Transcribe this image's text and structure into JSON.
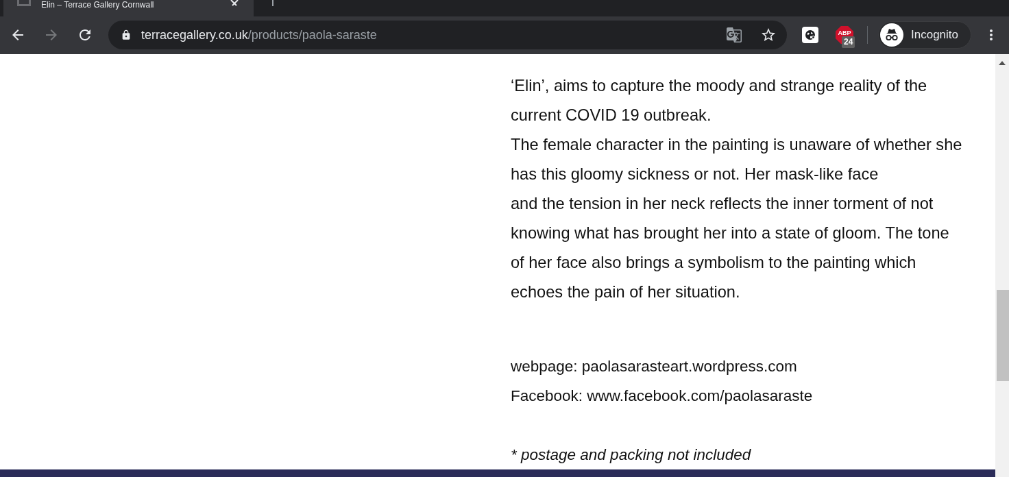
{
  "tab": {
    "title": "Elin – Terrace Gallery Cornwall"
  },
  "toolbar": {
    "navigation": [
      {
        "kind": "back",
        "disabled": false
      },
      {
        "kind": "forward",
        "disabled": true
      },
      {
        "kind": "reload",
        "disabled": false
      }
    ],
    "address_bar": {
      "domain": "terracegallery.co.uk",
      "path": "/products/paola-saraste"
    },
    "bookmarked": false,
    "extensions": [
      {
        "kind": "globe"
      },
      {
        "kind": "adblock",
        "label": "ABP",
        "badge": "24"
      }
    ],
    "profile": {
      "label": "Incognito"
    }
  },
  "page": {
    "paragraphs": [
      "‘Elin’, aims to capture the moody and strange reality of the current COVID 19 outbreak.",
      "The female character in the painting is unaware of whether she has this gloomy sickness or not. Her mask-like face",
      "and the tension in her neck reflects the inner torment of not knowing what has brought her into a state of gloom. The tone of her face also brings a symbolism to the painting which echoes the pain of her situation."
    ],
    "contacts": [
      "webpage: paolasarasteart.wordpress.com",
      "Facebook: www.facebook.com/paolasaraste"
    ],
    "note": "* postage and packing not included"
  }
}
